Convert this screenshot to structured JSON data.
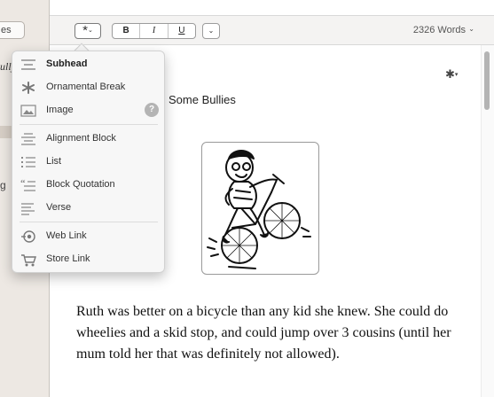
{
  "sidebar": {
    "button_label": "es",
    "title_fragment": "ully",
    "item_fragment": "g"
  },
  "toolbar": {
    "insert_symbol": "*",
    "insert_chevron": "⌄",
    "bold_label": "B",
    "italic_label": "I",
    "underline_label": "U",
    "more_label": "⌄",
    "word_count": "2326",
    "word_count_label": "Words",
    "word_count_chevron": "⌄"
  },
  "insert_menu": {
    "items": [
      {
        "label": "Subhead",
        "icon": "subhead-icon"
      },
      {
        "label": "Ornamental Break",
        "icon": "ornamental-break-icon"
      },
      {
        "label": "Image",
        "icon": "image-icon",
        "help": "?"
      },
      {
        "label": "Alignment Block",
        "icon": "alignment-block-icon"
      },
      {
        "label": "List",
        "icon": "list-icon"
      },
      {
        "label": "Block Quotation",
        "icon": "block-quotation-icon"
      },
      {
        "label": "Verse",
        "icon": "verse-icon"
      },
      {
        "label": "Web Link",
        "icon": "web-link-icon"
      },
      {
        "label": "Store Link",
        "icon": "store-link-icon"
      }
    ]
  },
  "editor": {
    "gear_symbol": "✱",
    "chapter_title": "Some Bullies",
    "illustration": "boy-on-bicycle-drawing",
    "body_text": "Ruth was better on a bicycle than any kid she knew. She could do wheelies and a skid stop, and could jump over 3 cousins (until her mum told her that was definitely not allowed)."
  },
  "colors": {
    "sidebar_bg": "#ede8e3",
    "toolbar_bg": "#f4f3f2",
    "menu_bg": "#f7f7f7",
    "scroll_thumb": "#b4b4b4"
  }
}
